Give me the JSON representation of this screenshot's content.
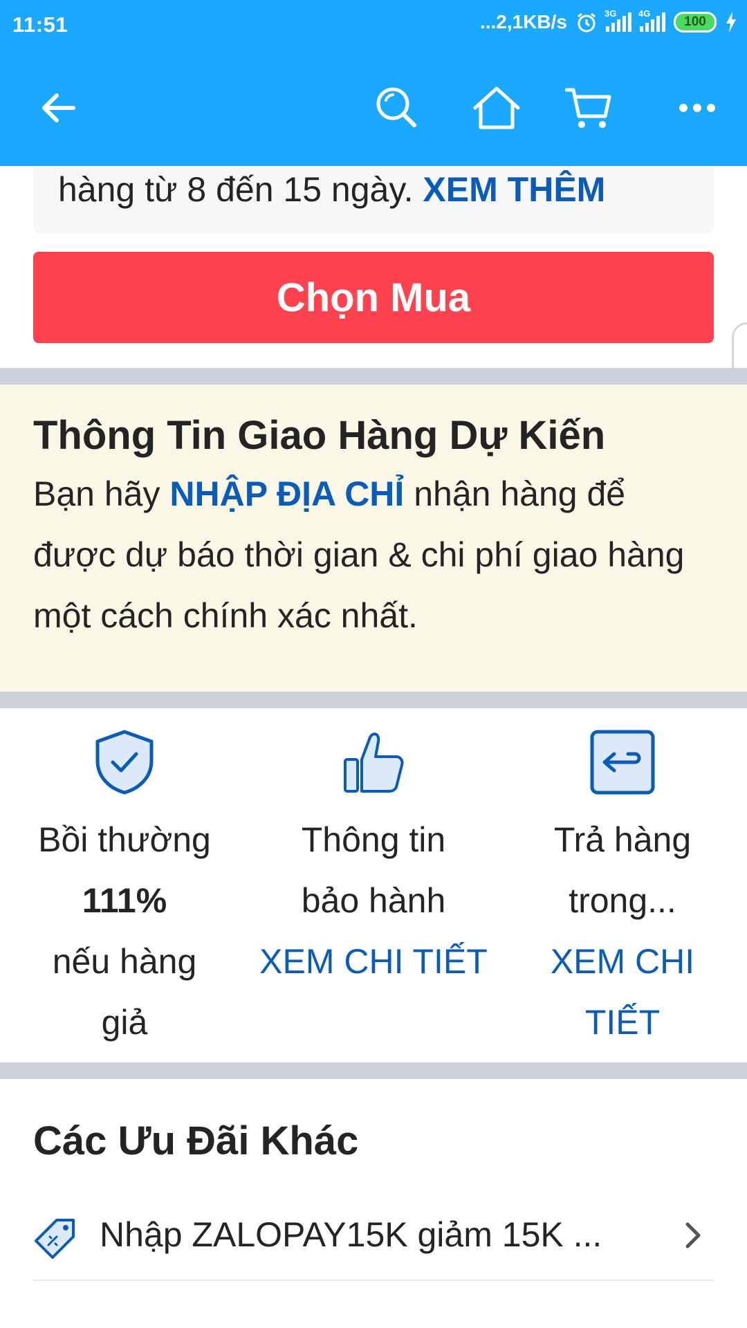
{
  "status_bar": {
    "time": "11:51",
    "network_speed": "...2,1KB/s",
    "network_1": "3G",
    "network_2": "4G",
    "battery": "100",
    "icons": [
      "alarm-icon",
      "signal-icon",
      "battery-icon",
      "charging-icon"
    ]
  },
  "nav": {
    "icons": [
      "back-arrow-icon",
      "search-icon",
      "home-icon",
      "cart-icon",
      "more-icon"
    ]
  },
  "note": {
    "text": "hàng từ 8 đến 15 ngày.",
    "link": "XEM THÊM"
  },
  "buy_button": {
    "label": "Chọn Mua"
  },
  "shipping": {
    "title": "Thông Tin Giao Hàng Dự Kiến",
    "text_before": "Bạn hãy",
    "link": "NHẬP ĐỊA CHỈ",
    "text_after": "nhận hàng để được dự báo thời gian & chi phí giao hàng một cách chính xác nhất."
  },
  "features": [
    {
      "icon": "shield-check-icon",
      "line1": "Bồi thường",
      "bold": "111%",
      "line3": "nếu hàng giả"
    },
    {
      "icon": "thumbs-up-icon",
      "line1": "Thông tin bảo hành",
      "link": "XEM CHI TIẾT"
    },
    {
      "icon": "return-icon",
      "line1": "Trả hàng trong...",
      "link": "XEM CHI TIẾT"
    }
  ],
  "offers": {
    "title": "Các Ưu Đãi Khác",
    "items": [
      {
        "icon": "coupon-icon",
        "label": "Nhập ZALOPAY15K giảm 15K ..."
      }
    ]
  },
  "colors": {
    "header_blue": "#1ba8ff",
    "buy_red": "#ff424f",
    "link_blue": "#0b5cb8",
    "shipping_bg": "#fbf7e6"
  }
}
